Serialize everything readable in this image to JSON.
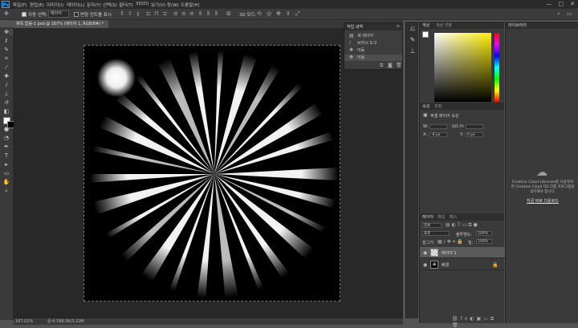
{
  "app": {
    "logo": "Ps"
  },
  "menu": {
    "items": [
      "파일(F)",
      "편집(E)",
      "이미지(I)",
      "레이어(L)",
      "문자(Y)",
      "선택(S)",
      "필터(T)",
      "3D(D)",
      "보기(V)",
      "창(W)",
      "도움말(H)"
    ]
  },
  "window_controls": {
    "minimize": "—",
    "maximize": "□",
    "close": "✕"
  },
  "options": {
    "auto_select_label": "자동 선택:",
    "auto_select_value": "레이어",
    "show_transform_label": "변형 컨트롤 표시",
    "mode_3d_label": "3D 모드:"
  },
  "document": {
    "tab_title": "제목 없음-1.psd @ 167% (레이어 1, RGB/8#) *",
    "zoom": "167.02%",
    "doc_info": "문서:768.0K/3.22M"
  },
  "history": {
    "tabs": [
      "작업 내역"
    ],
    "items": [
      {
        "label": "새 레이어",
        "icon": "new-layer"
      },
      {
        "label": "브러시 도구",
        "icon": "brush"
      },
      {
        "label": "이동",
        "icon": "move"
      },
      {
        "label": "이동",
        "icon": "move"
      }
    ]
  },
  "color_panel": {
    "tabs": [
      "색상",
      "색상 견본"
    ]
  },
  "properties_panel": {
    "tabs": [
      "속성",
      "조정"
    ],
    "title": "픽셀 레이어 속성",
    "w_label": "W:",
    "h_label": "H:",
    "x_label": "X:",
    "y_label": "Y:",
    "x_value": "-6 px",
    "y_value": "0 px",
    "link_label": "GO"
  },
  "layers_panel": {
    "tabs": [
      "레이어",
      "채널",
      "패스"
    ],
    "filter_kind": "종류",
    "blend_mode": "표준",
    "opacity_label": "불투명도:",
    "opacity_value": "100%",
    "lock_label": "잠그기:",
    "fill_label": "칠:",
    "fill_value": "100%",
    "layers": [
      {
        "name": "레이어 1",
        "selected": true
      },
      {
        "name": "배경",
        "selected": false
      }
    ]
  },
  "library": {
    "tab": "라이브러리",
    "message": "Creative Cloud Libraries를 사용하려면 Creative Cloud 데스크톱 프로그램을 설치해야 합니다.",
    "install_link": "지금 바로 다운로드"
  },
  "colors": {
    "accent": "#31a8ff",
    "panel": "#3a3a3a",
    "canvas_bg": "#282828"
  }
}
